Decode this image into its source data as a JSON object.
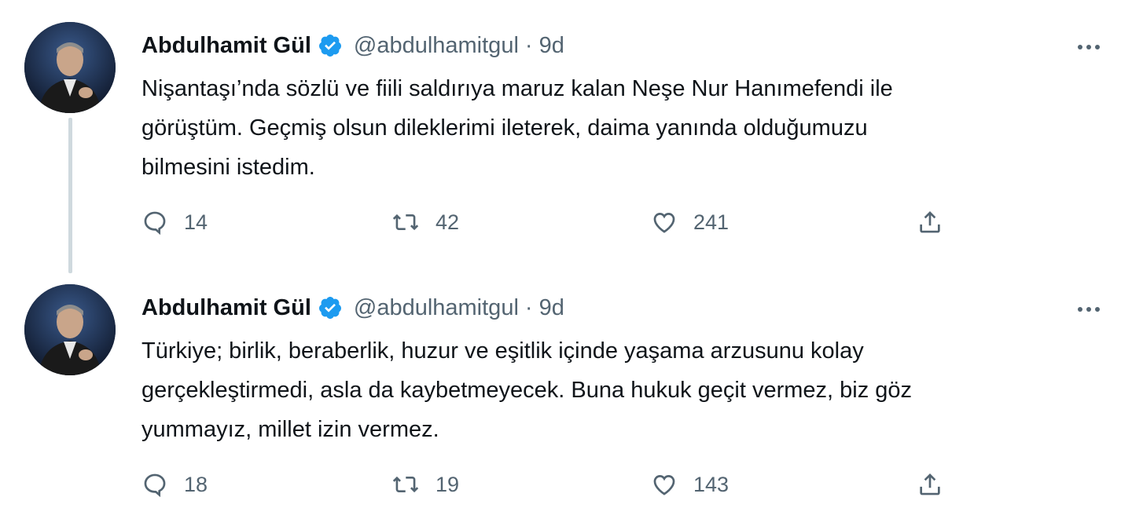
{
  "tweets": [
    {
      "author": {
        "name": "Abdulhamit Gül",
        "handle": "@abdulhamitgul",
        "verified": true
      },
      "separator": "·",
      "time": "9d",
      "text_lines": [
        "Nişantaşı’nda sözlü ve fiili saldırıya maruz kalan Neşe Nur Hanımefendi ile",
        "görüştüm. Geçmiş olsun dileklerimi ileterek, daima yanında olduğumuzu",
        "bilmesini istedim."
      ],
      "actions": {
        "reply_count": "14",
        "retweet_count": "42",
        "like_count": "241"
      }
    },
    {
      "author": {
        "name": "Abdulhamit Gül",
        "handle": "@abdulhamitgul",
        "verified": true
      },
      "separator": "·",
      "time": "9d",
      "text_lines": [
        "Türkiye; birlik, beraberlik, huzur ve eşitlik içinde yaşama arzusunu kolay",
        "gerçekleştirmedi, asla da kaybetmeyecek. Buna hukuk geçit vermez, biz göz",
        "yummayız, millet izin vermez."
      ],
      "actions": {
        "reply_count": "18",
        "retweet_count": "19",
        "like_count": "143"
      }
    }
  ],
  "icons": {
    "verified": "verified-badge-icon",
    "more": "more-options-icon",
    "reply": "reply-icon",
    "retweet": "retweet-icon",
    "like": "heart-icon",
    "share": "share-icon"
  },
  "colors": {
    "verified": "#1d9bf0",
    "secondary_text": "#536471",
    "primary_text": "#0f1419",
    "thread_line": "#cfd9de"
  }
}
